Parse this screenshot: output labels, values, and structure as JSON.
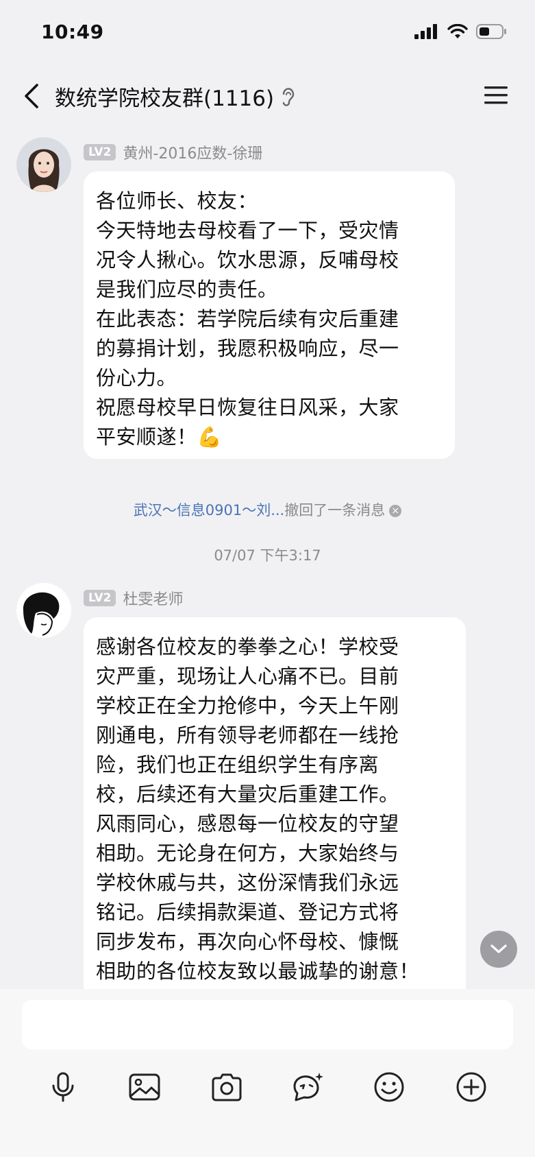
{
  "status_bar": {
    "time": "10:49"
  },
  "header": {
    "title": "数统学院校友群(1116)"
  },
  "messages": [
    {
      "level": "LV2",
      "sender": "黄州-2016应数-徐珊",
      "lines": [
        "各位师长、校友：",
        "今天特地去母校看了一下，受灾情",
        "况令人揪心。饮水思源，反哺母校",
        "是我们应尽的责任。",
        "在此表态：若学院后续有灾后重建",
        "的募捐计划，我愿积极响应，尽一",
        "份心力。",
        "祝愿母校早日恢复往日风采，大家",
        "平安顺遂！💪"
      ]
    },
    {
      "level": "LV2",
      "sender": "杜雯老师",
      "lines": [
        "感谢各位校友的拳拳之心！学校受",
        "灾严重，现场让人心痛不已。目前",
        "学校正在全力抢修中，今天上午刚",
        "刚通电，所有领导老师都在一线抢",
        "险，我们也正在组织学生有序离",
        "校，后续还有大量灾后重建工作。",
        "风雨同心，感恩每一位校友的守望",
        "相助。无论身在何方，大家始终与",
        "学校休戚与共，这份深情我们永远",
        "铭记。后续捐款渠道、登记方式将",
        "同步发布，再次向心怀母校、慷慨",
        "相助的各位校友致以最诚挚的谢意！"
      ]
    }
  ],
  "recall": {
    "who": "武汉～信息0901～刘...",
    "action": "撤回了一条消息"
  },
  "timestamp": "07/07 下午3:17",
  "input": {
    "value": ""
  }
}
